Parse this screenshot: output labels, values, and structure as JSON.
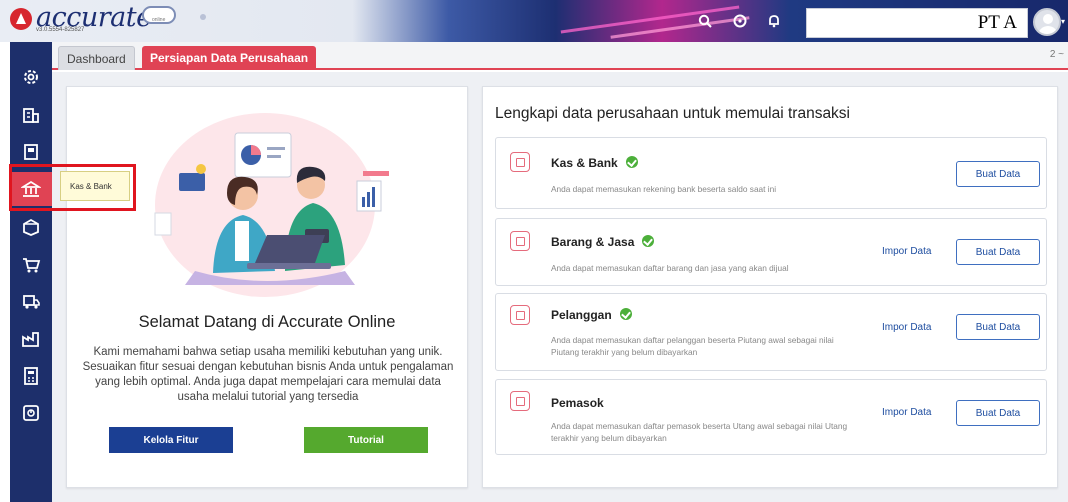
{
  "app": {
    "logo_text": "accurate",
    "logo_subtext": "online",
    "version": "v3.0.5554-825827",
    "company": "PT A"
  },
  "topbar_icons": [
    "search-icon",
    "help-icon",
    "bell-icon"
  ],
  "sidebar": {
    "items": [
      {
        "icon": "gear-icon"
      },
      {
        "icon": "building-icon"
      },
      {
        "icon": "book-icon"
      },
      {
        "icon": "bank-icon",
        "active": true
      },
      {
        "icon": "box-icon"
      },
      {
        "icon": "cart-icon"
      },
      {
        "icon": "truck-icon"
      },
      {
        "icon": "factory-icon"
      },
      {
        "icon": "calculator-icon"
      },
      {
        "icon": "report-icon"
      }
    ],
    "tooltip": "Kas & Bank"
  },
  "tabs": [
    {
      "label": "Dashboard",
      "active": false
    },
    {
      "label": "Persiapan Data Perusahaan",
      "active": true
    }
  ],
  "tab_counter": "2 ~",
  "welcome": {
    "title": "Selamat Datang di Accurate Online",
    "description": "Kami memahami bahwa setiap usaha memiliki kebutuhan yang unik. Sesuaikan fitur sesuai dengan kebutuhan bisnis Anda untuk pengalaman yang lebih optimal. Anda juga dapat mempelajari cara memulai data usaha melalui tutorial yang tersedia",
    "btn_kelola": "Kelola Fitur",
    "btn_tutorial": "Tutorial"
  },
  "setup": {
    "title": "Lengkapi data perusahaan untuk memulai transaksi",
    "impor_label": "Impor Data",
    "buat_label": "Buat Data",
    "rows": [
      {
        "title": "Kas & Bank",
        "done": true,
        "desc": "Anda dapat memasukan rekening bank beserta saldo saat ini",
        "has_import": false
      },
      {
        "title": "Barang & Jasa",
        "done": true,
        "desc": "Anda dapat memasukan daftar barang dan jasa yang akan dijual",
        "has_import": true
      },
      {
        "title": "Pelanggan",
        "done": true,
        "desc": "Anda dapat memasukan daftar pelanggan beserta Piutang awal sebagai nilai Piutang terakhir yang belum dibayarkan",
        "has_import": true
      },
      {
        "title": "Pemasok",
        "done": false,
        "desc": "Anda dapat memasukan daftar pemasok beserta Utang awal sebagai nilai Utang terakhir yang belum dibayarkan",
        "has_import": true
      }
    ]
  },
  "colors": {
    "brand_navy": "#1d2f6b",
    "accent_red": "#e04354",
    "success_green": "#4caf3a",
    "link_blue": "#1f4ea0"
  }
}
